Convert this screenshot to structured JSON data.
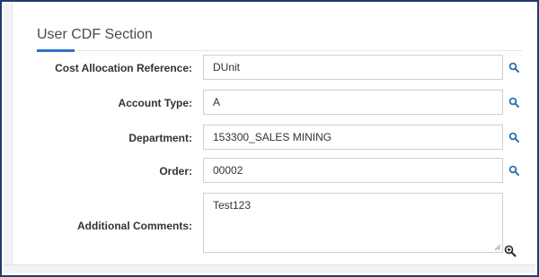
{
  "section": {
    "title": "User CDF Section"
  },
  "fields": [
    {
      "label": "Cost Allocation Reference:",
      "value": "DUnit",
      "icon": "search-icon"
    },
    {
      "label": "Account Type:",
      "value": "A",
      "icon": "search-icon"
    },
    {
      "label": "Department:",
      "value": "153300_SALES MINING",
      "icon": "search-icon"
    },
    {
      "label": "Order:",
      "value": "00002",
      "icon": "search-icon"
    }
  ],
  "comments": {
    "label": "Additional Comments:",
    "value": "Test123",
    "icon": "zoom-in-icon"
  },
  "colors": {
    "accent": "#2f74c9",
    "frame": "#1f3b6e",
    "icon": "#2a6db5"
  }
}
